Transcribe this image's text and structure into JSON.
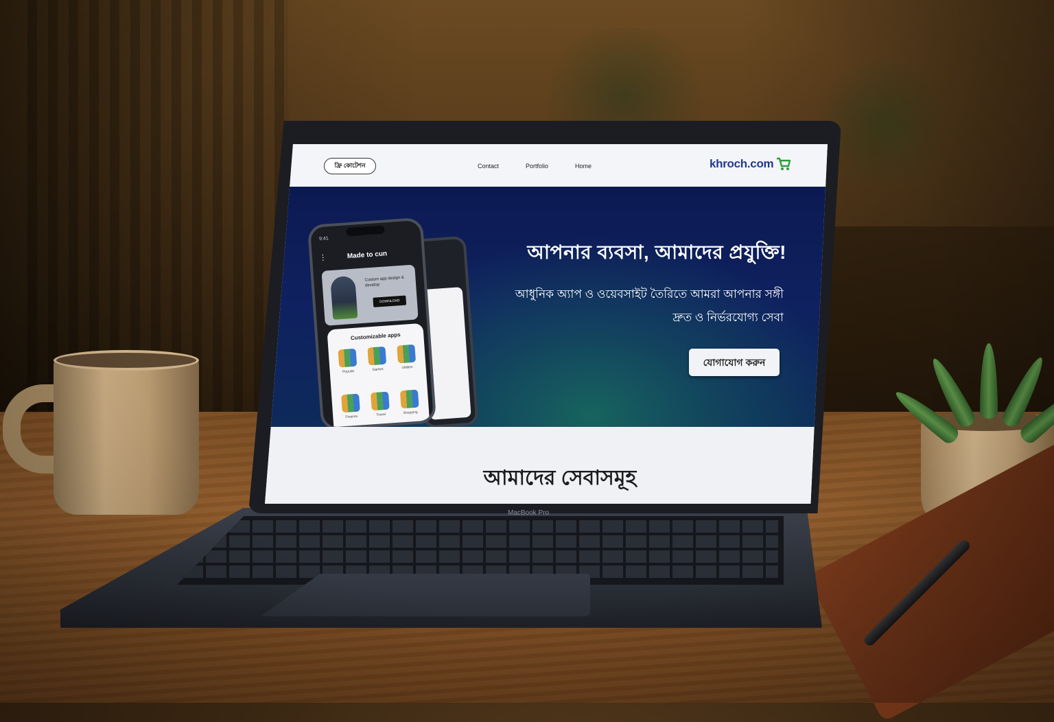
{
  "site": {
    "brand": "khroch.com",
    "nav_cta": "ফ্রি কোটেশন",
    "nav_links": [
      "Home",
      "Portfolio",
      "Contact"
    ]
  },
  "hero": {
    "title": "আপনার ব্যবসা, আমাদের প্রযুক্তি!",
    "subtitle_line1": "আধুনিক অ্যাপ ও ওয়েবসাইট তৈরিতে আমরা আপনার সঙ্গী",
    "subtitle_line2": "দ্রুত ও নির্ভরযোগ্য সেবা",
    "cta": "যোগাযোগ করুন"
  },
  "phone": {
    "status": "9:41",
    "header": "Made to cun",
    "card_text": "Custom app design & develop",
    "card_button": "DOWNLOAD",
    "panel_title": "Customizable apps",
    "apps": [
      "Popular",
      "Games",
      "Utilities",
      "Finance",
      "Travel",
      "Shopping"
    ]
  },
  "section": {
    "title": "আমাদের সেবাসমূহ"
  },
  "device": {
    "label": "MacBook Pro"
  },
  "colors": {
    "hero_top": "#0c1a52",
    "hero_glow": "#17635f",
    "brand_blue": "#213a8f",
    "cart_green": "#2e9a3a"
  }
}
